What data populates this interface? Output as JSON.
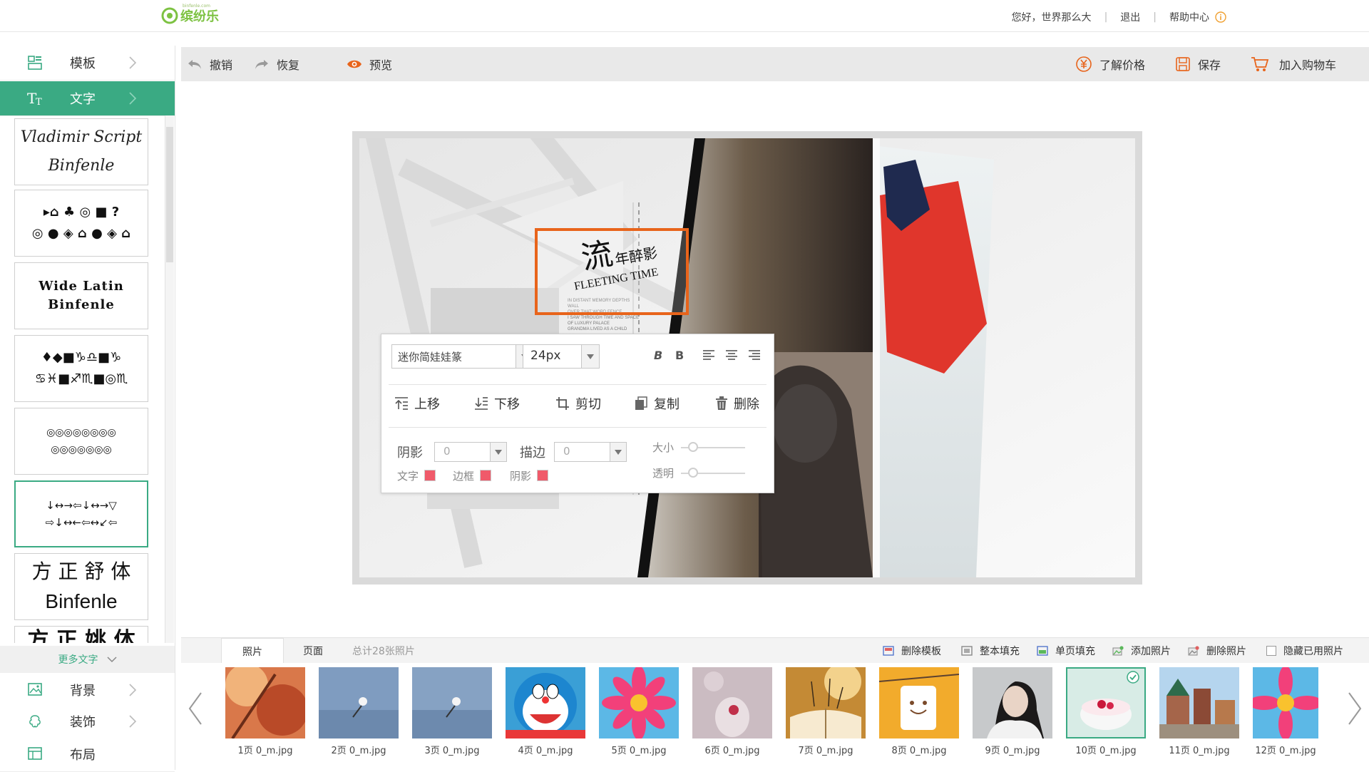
{
  "header": {
    "logo_text": "缤纷乐",
    "logo_sub": "binfenle.com",
    "greeting": "您好，世界那么大",
    "logout": "退出",
    "help": "帮助中心"
  },
  "sidebar": {
    "template": "模板",
    "text": "文字",
    "more_text": "更多文字",
    "background": "背景",
    "decoration": "装饰",
    "layout": "布局",
    "fonts": [
      {
        "line1": "Vladimir Script",
        "line2": "Binfenle"
      },
      {
        "line1": "▸⌂ ♣ ◎ ■ ?",
        "line2": "◎ ● ◈ ⌂ ● ◈ ⌂"
      },
      {
        "line1": "Wide Latin",
        "line2": "Binfenle"
      },
      {
        "line1": "♦◆■♑♎■♑",
        "line2": "♋♓■♐♏■◎♏"
      },
      {
        "line1": "◎◎◎◎◎◎◎◎",
        "line2": "◎◎◎◎◎◎◎"
      },
      {
        "line1": "↓↔→⇦↓↔→▽",
        "line2": "⇨↓↔←⇦↔↙⇦"
      },
      {
        "line1": "方 正 舒 体",
        "line2": "Binfenle"
      },
      {
        "line1": "方 正 姚 体",
        "line2": ""
      }
    ]
  },
  "toolbar": {
    "undo": "撤销",
    "redo": "恢复",
    "preview": "预览",
    "price": "了解价格",
    "save": "保存",
    "cart": "加入购物车"
  },
  "canvas": {
    "title_cn_big": "流",
    "title_cn_rest": "年醉影",
    "title_en": "FLEETING TIME",
    "small_lines": [
      "IN DISTANT MEMORY DEPTHS",
      "WALL",
      "OVER THAT WORD FENCE",
      "I SAW THROUGH TIME AND SPACE",
      "OF LUXURY PALACE",
      "GRANDMA LIVED AS A CHILD"
    ]
  },
  "text_popup": {
    "font_value": "迷你简娃娃篆",
    "size_value": "24px",
    "bold_italic": "B",
    "bold": "B",
    "up": "上移",
    "down": "下移",
    "crop": "剪切",
    "copy": "复制",
    "delete": "删除",
    "shadow": "阴影",
    "shadow_value": "0",
    "stroke": "描边",
    "stroke_value": "0",
    "size_label": "大小",
    "opacity_label": "透明",
    "color_text": "文字",
    "color_border": "边框",
    "color_shadow": "阴影"
  },
  "bottom": {
    "tab_photo": "照片",
    "tab_page": "页面",
    "total": "总计28张照片",
    "delete_template": "删除模板",
    "fill_all": "整本填充",
    "fill_page": "单页填充",
    "add_photo": "添加照片",
    "delete_photo": "删除照片",
    "hide_used": "隐藏已用照片",
    "photos": [
      {
        "caption": "1页  0_m.jpg"
      },
      {
        "caption": "2页  0_m.jpg"
      },
      {
        "caption": "3页  0_m.jpg"
      },
      {
        "caption": "4页  0_m.jpg"
      },
      {
        "caption": "5页  0_m.jpg"
      },
      {
        "caption": "6页  0_m.jpg"
      },
      {
        "caption": "7页  0_m.jpg"
      },
      {
        "caption": "8页  0_m.jpg"
      },
      {
        "caption": "9页  0_m.jpg"
      },
      {
        "caption": "10页 0_m.jpg"
      },
      {
        "caption": "11页 0_m.jpg"
      },
      {
        "caption": "12页 0_m.jpg"
      }
    ]
  },
  "colors": {
    "accent": "#3aaa83",
    "highlight": "#e8641b",
    "swatch": "#f05a6a"
  }
}
